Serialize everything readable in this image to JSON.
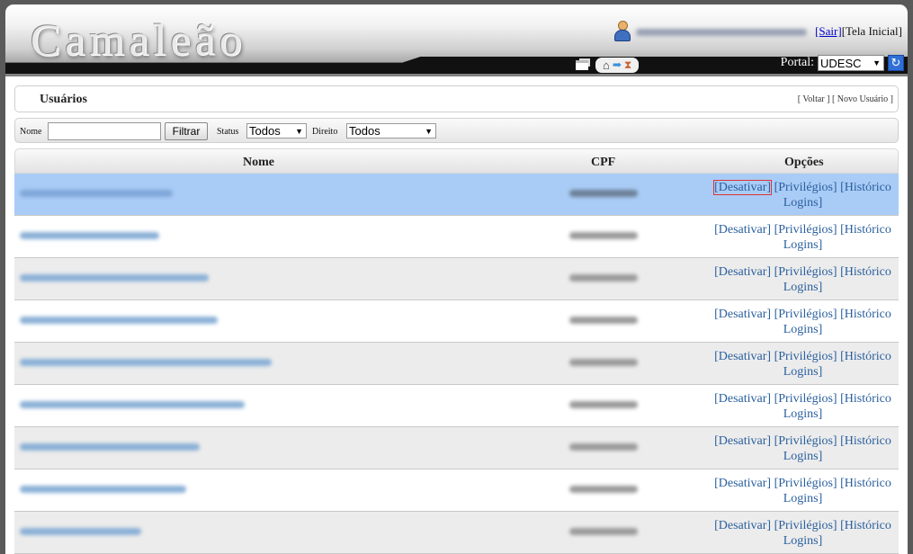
{
  "app": {
    "logo": "Camaleão",
    "sair": "[Sair]",
    "tela_inicial": "[Tela Inicial]",
    "portal_label": "Portal:",
    "portal_value": "UDESC"
  },
  "page": {
    "title": "Usuários",
    "back_link": "[ Voltar ]",
    "new_user_link": "[ Novo Usuário ]"
  },
  "filters": {
    "nome_label": "Nome",
    "nome_value": "",
    "filter_button": "Filtrar",
    "status_label": "Status",
    "status_value": "Todos",
    "direito_label": "Direito",
    "direito_value": "Todos"
  },
  "table": {
    "col_nome": "Nome",
    "col_cpf": "CPF",
    "col_opcoes": "Opções",
    "opt_desativar": "[Desativar]",
    "opt_privilegios": "[Privilégios]",
    "opt_historico": "[Histórico Logins]"
  },
  "colors": {
    "selected_row": "#a9ccf6",
    "link": "#2a5f9e",
    "focus_outline": "#dd3333"
  }
}
